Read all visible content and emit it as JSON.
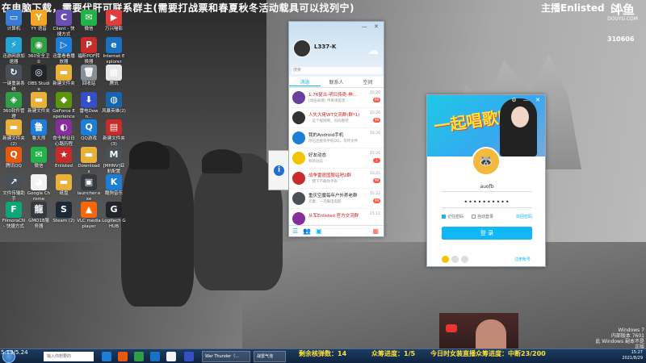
{
  "banner": {
    "text": "在电脑下载，需要代肝可联系群主(需要打战票和春夏秋冬活动载具可以找列宁)",
    "right": "主播Enlisted（八",
    "logo": "斗鱼",
    "logo_sub": "DOUYU.COM",
    "room_id": "310606"
  },
  "desktop_icons": [
    {
      "label": "计算机",
      "color": "#3a7bd5",
      "glyph": "▭"
    },
    {
      "label": "YY 语音",
      "color": "#f5a623",
      "glyph": "Y"
    },
    {
      "label": "Client - 快捷方式",
      "color": "#6a4fb5",
      "glyph": "C"
    },
    {
      "label": "微信",
      "color": "#24b34b",
      "glyph": "✉"
    },
    {
      "label": "万兴喵影",
      "color": "#e03d3d",
      "glyph": "▶"
    },
    {
      "label": "迅游网游加速器",
      "color": "#23a5d8",
      "glyph": "⚡"
    },
    {
      "label": "360安全卫士",
      "color": "#2f9e44",
      "glyph": "◉"
    },
    {
      "label": "迅雷看看播放器",
      "color": "#1c7ed6",
      "glyph": "▷"
    },
    {
      "label": "福昕PDF转换器",
      "color": "#c92a2a",
      "glyph": "P"
    },
    {
      "label": "Internet Explorer",
      "color": "#1971c2",
      "glyph": "e"
    },
    {
      "label": "一键重装系统",
      "color": "#495057",
      "glyph": "↻"
    },
    {
      "label": "OBS Studio",
      "color": "#212529",
      "glyph": "◎"
    },
    {
      "label": "新建文件夹",
      "color": "#e8b23a",
      "glyph": "▬"
    },
    {
      "label": "回收站",
      "color": "#868e96",
      "glyph": "🗑"
    },
    {
      "label": "腾讯",
      "color": "#e8e8e8",
      "glyph": "▦"
    },
    {
      "label": "360软件管理",
      "color": "#2f9e44",
      "glyph": "◈"
    },
    {
      "label": "新建文件夹",
      "color": "#e8b23a",
      "glyph": "▬"
    },
    {
      "label": "GeForce Experience",
      "color": "#5c940d",
      "glyph": "◆"
    },
    {
      "label": "雷电Down...",
      "color": "#364fc7",
      "glyph": "⬇"
    },
    {
      "label": "风暴英雄(2)",
      "color": "#1864ab",
      "glyph": "◍"
    },
    {
      "label": "新建文件夹(2)",
      "color": "#e8b23a",
      "glyph": "▬"
    },
    {
      "label": "鲁大师",
      "color": "#1c7ed6",
      "glyph": "鲁"
    },
    {
      "label": "命令毕业日心路历程",
      "color": "#862e9c",
      "glyph": "◐"
    },
    {
      "label": "QQ游戏",
      "color": "#1c7ed6",
      "glyph": "Q"
    },
    {
      "label": "新建文件夹(3)",
      "color": "#c92a2a",
      "glyph": "▤"
    },
    {
      "label": "腾讯QQ",
      "color": "#e8590c",
      "glyph": "Q"
    },
    {
      "label": "微信",
      "color": "#24b34b",
      "glyph": "✉"
    },
    {
      "label": "Enlisted",
      "color": "#c92a2a",
      "glyph": "★"
    },
    {
      "label": "Downloads",
      "color": "#e8b23a",
      "glyph": "▬"
    },
    {
      "label": "[MHNV]亚航配置",
      "color": "#495057",
      "glyph": "M"
    },
    {
      "label": "文件传输助手",
      "color": "#495057",
      "glyph": "↗"
    },
    {
      "label": "Google Chrome",
      "color": "#f1f3f5",
      "glyph": "◕"
    },
    {
      "label": "纸盘",
      "color": "#e8b23a",
      "glyph": "▬"
    },
    {
      "label": "launcher.exe",
      "color": "#343a40",
      "glyph": "▣"
    },
    {
      "label": "酷狗音乐",
      "color": "#1c7ed6",
      "glyph": "K"
    },
    {
      "label": "FilmoraCN - 快捷方式",
      "color": "#0ca678",
      "glyph": "F"
    },
    {
      "label": "GMO18服务器",
      "color": "#343a40",
      "glyph": "龍"
    },
    {
      "label": "Steam (2)",
      "color": "#1b2838",
      "glyph": "S"
    },
    {
      "label": "VLC media player",
      "color": "#f76707",
      "glyph": "▲"
    },
    {
      "label": "Logitech G HUB",
      "color": "#212529",
      "glyph": "G"
    }
  ],
  "qq_main": {
    "nickname": "L337-K",
    "search_placeholder": "搜索",
    "tabs": [
      "消息",
      "联系人",
      "空间"
    ],
    "messages": [
      {
        "title": "1.76复古-明日传奇-神...",
        "sub": "[动画表情] 传奇请留意...",
        "time": "15:20",
        "badge": "99",
        "color": "#6a3fa0",
        "red": true
      },
      {
        "title": "人失大佬WT交流群(群*1)",
        "sub": "：这个规则啊，问问看吧",
        "time": "15:26",
        "badge": "99",
        "color": "#333",
        "red": true
      },
      {
        "title": "我的Android手机",
        "sub": "你已连接到手机QQ，可传文件",
        "time": "15:26",
        "badge": "",
        "color": "#1c7ed6",
        "red": false
      },
      {
        "title": "好友动态",
        "sub": "有新动态",
        "time": "15:26",
        "badge": "1",
        "color": "#f5c400",
        "red": false
      },
      {
        "title": "战争雷霆国服站吧2群",
        "sub": "：我下不载你手表",
        "time": "15:25",
        "badge": "99",
        "color": "#c92a2a",
        "red": true
      },
      {
        "title": "重庆空魔每年户外养老群",
        "sub": "元素：一次脚电电影",
        "time": "15:22",
        "badge": "99",
        "color": "#495057",
        "red": false
      },
      {
        "title": "从军Enlisted 官方交流群",
        "sub": "",
        "time": "15:12",
        "badge": "",
        "color": "#862e9c",
        "red": true
      }
    ]
  },
  "qq_login": {
    "banner_text": "一起唱歌吧",
    "account": "auofb",
    "password": "••••••••••",
    "remember": "记住密码",
    "auto_login": "自动登录",
    "forgot": "找回密码",
    "login_button": "登 录",
    "register": "注册账号"
  },
  "taskbar": {
    "search_placeholder": "输入你想要的",
    "windows": [
      "War Thunder（...",
      "战雷气泡"
    ],
    "clock_time": "15:27",
    "clock_date": "2021/8/29"
  },
  "overlay": {
    "time_left": "5.13/5.24",
    "danmu": "剩余核弹数：14",
    "progress": "众筹进度：1/5",
    "live": "今日时女装直播众筹进度：中断23/200"
  },
  "watermark": {
    "line1": "Windows 7",
    "line2": "内部版本 7601",
    "line3": "此 Windows 副本不是正版"
  }
}
